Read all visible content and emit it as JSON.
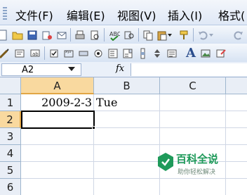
{
  "menubar": {
    "items": [
      "文件(F)",
      "编辑(E)",
      "视图(V)",
      "插入(I)",
      "格式("
    ]
  },
  "toolbar1": {
    "icons": [
      "new-icon",
      "open-icon",
      "save-icon",
      "permission-icon",
      "email-icon",
      "print-icon",
      "print-preview-icon",
      "spelling-icon",
      "research-icon",
      "copy-icon",
      "paste-icon",
      "format-painter-icon",
      "undo-icon",
      "chevron-down-icon",
      "redo-icon"
    ]
  },
  "toolbar2": {
    "icons": [
      "drawing-icon",
      "properties-icon",
      "textbox-icon",
      "checkbox-icon",
      "groupbox-icon",
      "button-icon",
      "radio-icon",
      "listbox-icon",
      "combobox-icon",
      "scrollbar-icon",
      "spinner-icon",
      "label-icon",
      "image-icon",
      "settings-icon"
    ],
    "label_glyph": "A"
  },
  "formula_bar": {
    "name_box": "A2",
    "fx_label": "fx",
    "formula": ""
  },
  "grid": {
    "columns": [
      "A",
      "B",
      "C"
    ],
    "rows": [
      "1",
      "2",
      "3",
      "4",
      "5",
      "6"
    ],
    "cells": {
      "A1": "2009-2-3",
      "B1": "Tue"
    }
  },
  "watermark": {
    "title": "百科全说",
    "subtitle": "助你轻松解决"
  },
  "colors": {
    "active_header": "#f9d99f",
    "header_bg": "#e9eef6",
    "gridline": "#d0d7e5",
    "brand_green": "#1f9a5a"
  }
}
